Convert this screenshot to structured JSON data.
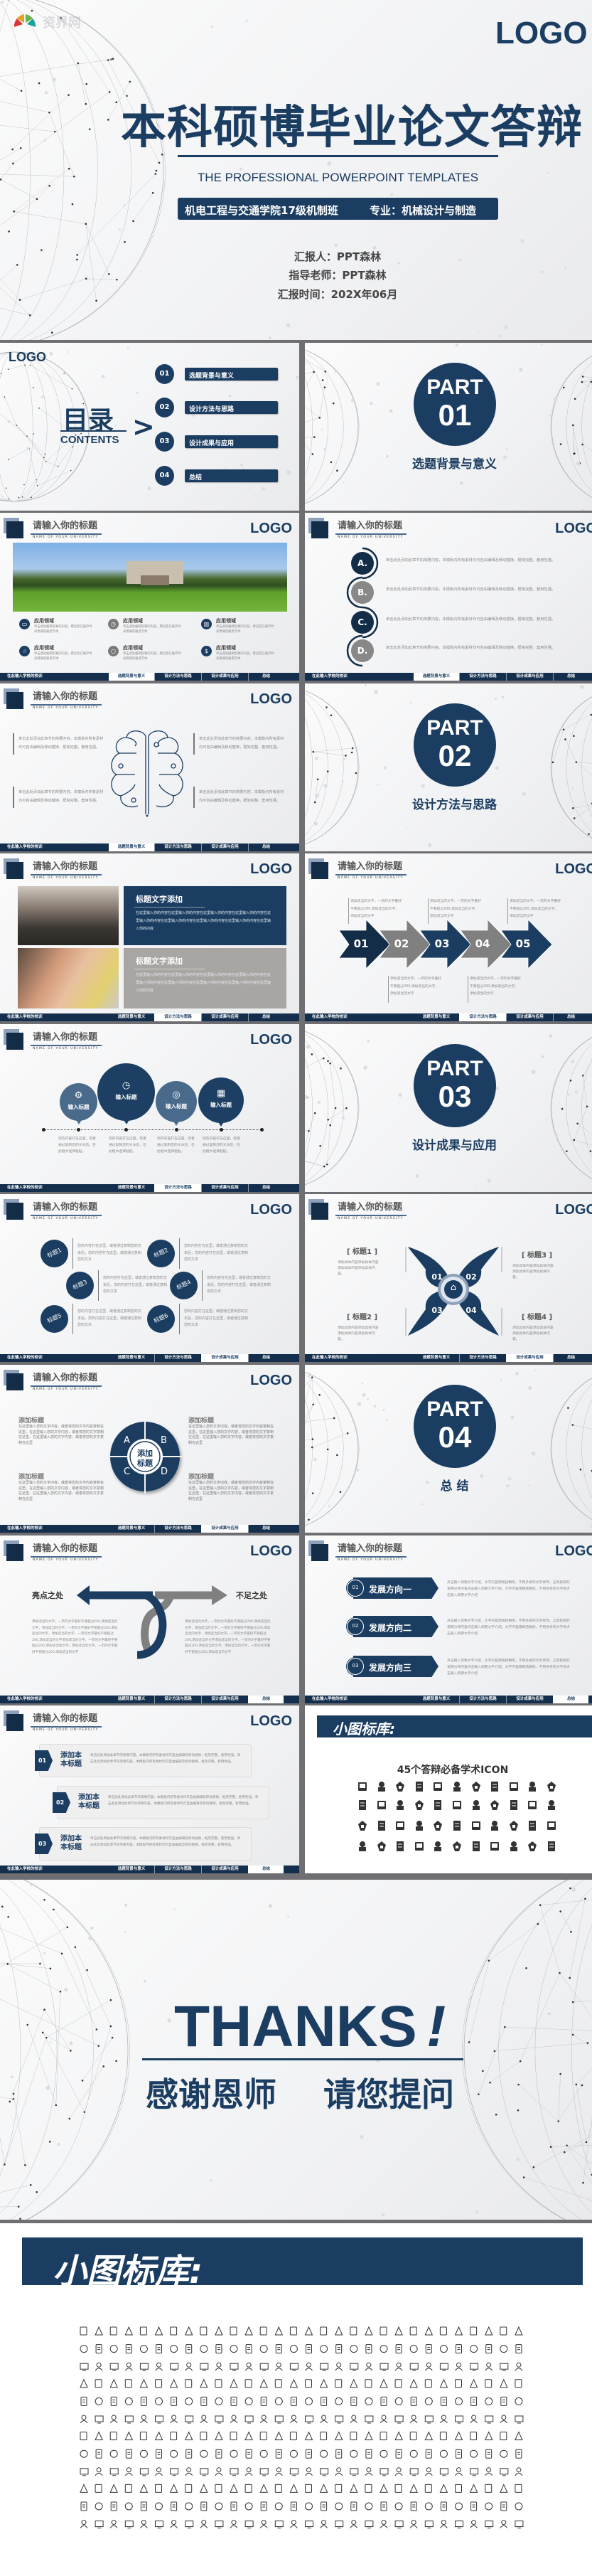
{
  "colors": {
    "navy": "#1b3d61",
    "dark_navy": "#132c48",
    "gray": "#808080",
    "light_steel": "#8fa1ba"
  },
  "cover": {
    "watermark": "资界网",
    "logo": "LOGO",
    "title": "本科硕博毕业论文答辩",
    "subtitle": "THE PROFESSIONAL POWERPOINT TEMPLATES",
    "class_info": "机电工程与交通学院17级机制班",
    "major": "专业：机械设计与制造",
    "reporter": "汇报人：PPT森林",
    "advisor": "指导老师：PPT森林",
    "date": "汇报时间：202X年06月"
  },
  "common": {
    "slide_title": "请输入你的标题",
    "slide_subtitle": "NAME OF YOUR UNIVERSITY",
    "logo": "LOGO",
    "motto": "在此输入学校的校训",
    "nav": [
      "选题背景与意义",
      "设计方法与思路",
      "设计成果与应用",
      "总结"
    ]
  },
  "contents": {
    "logo": "LOGO",
    "title": "目录",
    "subtitle": "CONTENTS",
    "chevron": ">",
    "items": [
      {
        "num": "01",
        "label": "选题背景与意义"
      },
      {
        "num": "02",
        "label": "设计方法与思路"
      },
      {
        "num": "03",
        "label": "设计成果与应用"
      },
      {
        "num": "04",
        "label": "总结"
      }
    ]
  },
  "parts": [
    {
      "label": "PART",
      "num": "01",
      "title": "选题背景与意义"
    },
    {
      "label": "PART",
      "num": "02",
      "title": "设计方法与思路"
    },
    {
      "label": "PART",
      "num": "03",
      "title": "设计成果与应用"
    },
    {
      "label": "PART",
      "num": "04",
      "title": "总 结"
    }
  ],
  "campus": {
    "active_nav": 0,
    "items": [
      {
        "icon": "folder-icon",
        "glyph": "▭",
        "title": "应用领域",
        "desc": "单击此处编辑您要的内容，建议您在展示时采用微软雅黑字体"
      },
      {
        "icon": "clock-icon",
        "glyph": "◷",
        "title": "应用领域",
        "desc": "单击此处编辑您要的内容，建议您在展示时采用微软雅黑字体"
      },
      {
        "icon": "bar-chart-icon",
        "glyph": "▥",
        "title": "应用领域",
        "desc": "单击此处编辑您要的内容，建议您在展示时采用微软雅黑字体"
      },
      {
        "icon": "thumbs-up-icon",
        "glyph": "☝",
        "title": "应用领域",
        "desc": "单击此处编辑您要的内容，建议您在展示时采用微软雅黑字体"
      },
      {
        "icon": "search-icon",
        "glyph": "○",
        "title": "应用领域",
        "desc": "单击此处编辑您要的内容，建议您在展示时采用微软雅黑字体"
      },
      {
        "icon": "money-bag-icon",
        "glyph": "$",
        "title": "应用领域",
        "desc": "单击此处编辑您要的内容，建议您在展示时采用微软雅黑字体"
      }
    ]
  },
  "abcd": {
    "active_nav": 0,
    "items": [
      {
        "letter": "A.",
        "text": "单击此处添加此章节的简要内容，本模板内所有素材均可自由编辑及移动替换，框架完整，套用性强。"
      },
      {
        "letter": "B.",
        "text": "单击此处添加此章节的简要内容，本模板内所有素材均可自由编辑及移动替换，框架完整，套用性强。"
      },
      {
        "letter": "C.",
        "text": "单击此处添加此章节的简要内容，本模板内所有素材均可自由编辑及移动替换，框架完整，套用性强。"
      },
      {
        "letter": "D.",
        "text": "单击此处添加此章节的简要内容，本模板内所有素材均可自由编辑及移动替换，框架完整，套用性强。"
      }
    ]
  },
  "brain": {
    "active_nav": 0,
    "texts": [
      "单击此处添加此章节的简要内容，本模板内所有素材均可自由编辑及移动替换，框架完整，套用性强。",
      "单击此处添加此章节的简要内容，本模板内所有素材均可自由编辑及移动替换，框架完整，套用性强。",
      "单击此处添加此章节的简要内容，本模板内所有素材均可自由编辑及移动替换，框架完整，套用性强。",
      "单击此处添加此章节的简要内容，本模板内所有素材均可自由编辑及移动替换，框架完整，套用性强。"
    ]
  },
  "photos": {
    "active_nav": 1,
    "boxes": [
      {
        "title": "标题文字添加",
        "text": "在这里输入你的内容在这里输入你的内容在这里输入你的内容在这里输入你的内容在这里输入你的内容在这里输入你的内容在这里输入你的内容在这里输入你的内容在这里输入你的内容"
      },
      {
        "title": "标题文字添加",
        "text": "在这里输入你的内容在这里输入你的内容在这里输入你的内容在这里输入你的内容在这里输入你的内容在这里输入你的内容在这里输入你的内容在这里输入你的内容在这里输入你的内容"
      }
    ]
  },
  "arrows": {
    "active_nav": 1,
    "steps": [
      "01",
      "02",
      "03",
      "04",
      "05"
    ],
    "text": "添加适当的文字，一页的文字最好不要超过200,添加适当的文字，添加适当的文字"
  },
  "bubbles": {
    "active_nav": 1,
    "items": [
      {
        "icon": "gear-icon",
        "glyph": "⚙",
        "label": "输入标题",
        "text": "您的内容打在这里，或者通过复制您的文本后，在此框中选择粘贴。"
      },
      {
        "icon": "clock-icon",
        "glyph": "◷",
        "label": "输入标题",
        "text": "您的内容打在这里，或者通过复制您的文本后，在此框中选择粘贴。"
      },
      {
        "icon": "search-icon",
        "glyph": "◎",
        "label": "输入标题",
        "text": "您的内容打在这里，或者通过复制您的文本后，在此框中选择粘贴。"
      },
      {
        "icon": "cart-icon",
        "glyph": "▦",
        "label": "输入标题",
        "text": "您的内容打在这里，或者通过复制您的文本后，在此框中选择粘贴。"
      }
    ]
  },
  "circles6": {
    "active_nav": 2,
    "items": [
      {
        "label": "标题1",
        "text": "您的内容打在这里，或者通过复制您的文本后，您的内容打在这里，或者通过复制您的文本"
      },
      {
        "label": "标题2",
        "text": "您的内容打在这里，或者通过复制您的文本后，您的内容打在这里，或者通过复制您的文本"
      },
      {
        "label": "标题3",
        "text": "您的内容打在这里，或者通过复制您的文本后，您的内容打在这里，或者通过复制您的文本"
      },
      {
        "label": "标题4",
        "text": "您的内容打在这里，或者通过复制您的文本后，您的内容打在这里，或者通过复制您的文本"
      },
      {
        "label": "标题5",
        "text": "您的内容打在这里，或者通过复制您的文本后，您的内容打在这里，或者通过复制您的文本"
      },
      {
        "label": "标题6",
        "text": "您的内容打在这里，或者通过复制您的文本后，您的内容打在这里，或者通过复制您的文本"
      }
    ]
  },
  "butterfly": {
    "active_nav": 2,
    "nums": [
      "01",
      "02",
      "03",
      "04"
    ],
    "center_icon": "home-icon",
    "items": [
      {
        "label": "[  标题1  ]",
        "text": "添加具体内容添加具体内容添加具体内容添加具体内容。"
      },
      {
        "label": "[  标题2  ]",
        "text": "添加具体内容添加具体内容添加具体内容添加具体内容。"
      },
      {
        "label": "[  标题3  ]",
        "text": "添加具体内容添加具体内容添加具体内容添加具体内容。"
      },
      {
        "label": "[  标题4  ]",
        "text": "添加具体内容添加具体内容添加具体内容添加具体内容。"
      }
    ]
  },
  "wheel": {
    "active_nav": 2,
    "center": [
      "添加",
      "标题"
    ],
    "letters": [
      "A",
      "B",
      "C",
      "D"
    ],
    "items": [
      {
        "title": "添加标题",
        "text": "在这里输入您的文字内容，或者将您的文字内容复制在这里，在这里输入您的文字内容，或者将您的文字复制在这里，在这里输入您的文字内容，或者将您的文字复制在这里"
      },
      {
        "title": "添加标题",
        "text": "在这里输入您的文字内容，或者将您的文字内容复制在这里，在这里输入您的文字内容，或者将您的文字复制在这里，在这里输入您的文字内容，或者将您的文字复制在这里"
      },
      {
        "title": "添加标题",
        "text": "在这里输入您的文字内容，或者将您的文字内容复制在这里，在这里输入您的文字内容，或者将您的文字复制在这里，在这里输入您的文字内容，或者将您的文字复制在这里"
      },
      {
        "title": "添加标题",
        "text": "在这里输入您的文字内容，或者将您的文字内容复制在这里，在这里输入您的文字内容，或者将您的文字复制在这里，在这里输入您的文字内容，或者将您的文字复制在这里"
      }
    ]
  },
  "cross": {
    "active_nav": 3,
    "left_label": "亮点之处",
    "right_label": "不足之处",
    "text": "添加适当的文字，一页的文字最好不要超过200,添加适当的文字，添加适当的文字，一页的文字最好不要超过200,添加适当的文字，添加适当的文字，一页的文字最好不要超过200,添加适当的文字添加适当的文字，一页的文字最好不要超过200,添加适当的文字，添加适当的文字，一页的文字最好不要超过200,添加适当的文字"
  },
  "directions": {
    "active_nav": 3,
    "items": [
      {
        "num": "01",
        "label": "发展方向一",
        "text": "点击输入简要文字介绍，文字内容需概括精炼，不用多余的文字修饰，言简意赅的说明分项内容点击输入简要文字介绍，文字内容需概括精炼，不用多余的文字修点击输入简要文字介绍"
      },
      {
        "num": "02",
        "label": "发展方向二",
        "text": "点击输入简要文字介绍，文字内容需概括精炼，不用多余的文字修饰，言简意赅的说明分项内容点击输入简要文字介绍，文字内容需概括精炼，不用多余的文字修点击输入简要文字介绍"
      },
      {
        "num": "03",
        "label": "发展方向三",
        "text": "点击输入简要文字介绍，文字内容需概括精炼，不用多余的文字修饰，言简意赅的说明分项内容点击输入简要文字介绍，文字内容需概括精炼，不用多余的文字修点击输入简要文字介绍"
      }
    ]
  },
  "cards": {
    "active_nav": 3,
    "items": [
      {
        "num": "01",
        "title": "添加本本标题",
        "text": "单击此处添加此章节的简要内容，本模板内所有素材均可自由编辑及移动替换，框架完整，套用性强。单击此处添加此章节的简要内容，本模板内所有素材均可自由编辑及移动替换，框架完整，套用性强。"
      },
      {
        "num": "02",
        "title": "添加本本标题",
        "text": "单击此处添加此章节的简要内容，本模板内所有素材均可自由编辑及移动替换，框架完整，套用性强。单击此处添加此章节的简要内容，本模板内所有素材均可自由编辑及移动替换，框架完整，套用性强。"
      },
      {
        "num": "03",
        "title": "添加本本标题",
        "text": "单击此处添加此章节的简要内容，本模板内所有素材均可自由编辑及移动替换，框架完整，套用性强。单击此处添加此章节的简要内容，本模板内所有素材均可自由编辑及移动替换，框架完整，套用性强。"
      }
    ]
  },
  "icons45": {
    "header": "小图标库:",
    "caption": "45个答辩必备学术ICON",
    "icons": [
      "blackboard",
      "microscope",
      "graduation-cap",
      "certificate",
      "museum",
      "graduate-male",
      "graduate-female",
      "notes",
      "bus",
      "abc-blocks",
      "scissors",
      "palette",
      "brush",
      "open-book",
      "pencil",
      "book-stack",
      "pencils",
      "document",
      "books",
      "laptop",
      "monitor",
      "backpack",
      "notebook",
      "scissors",
      "marker",
      "tablet",
      "triangle-ruler",
      "book",
      "computer",
      "mortarboard",
      "test-tube",
      "abacus",
      "flask",
      "compass",
      "school-bus",
      "globe",
      "apple-books",
      "pen-cup",
      "test-tubes",
      "search-laptop",
      "search-document",
      "teacher",
      "binders",
      "easel"
    ]
  },
  "thanks": {
    "title": "THANKS",
    "exclaim": "!",
    "sub1": "感谢恩师",
    "sub2": "请您提问"
  },
  "library": {
    "header": "小图标库:"
  }
}
